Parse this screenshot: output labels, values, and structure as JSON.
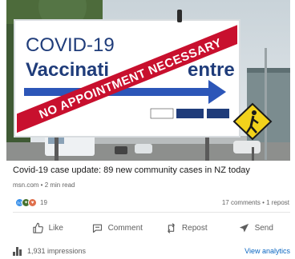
{
  "hero": {
    "sign_line1": "COVID-19",
    "sign_line2": "Vaccinati",
    "sign_line2_end": "entre",
    "banner": "NO APPOINTMENT NECESSARY",
    "sign_color": "#1f3c7a",
    "banner_color": "#c8102e"
  },
  "article": {
    "title": "Covid-19 case update: 89 new community cases in NZ today",
    "source": "msn.com • 2 min read"
  },
  "social": {
    "reaction_count": "19",
    "comments_reposts": "17 comments • 1 repost"
  },
  "actions": {
    "like": "Like",
    "comment": "Comment",
    "repost": "Repost",
    "send": "Send"
  },
  "footer": {
    "impressions": "1,931 impressions",
    "view_analytics": "View analytics"
  },
  "colors": {
    "link": "#0a66c2",
    "muted": "#666666"
  }
}
